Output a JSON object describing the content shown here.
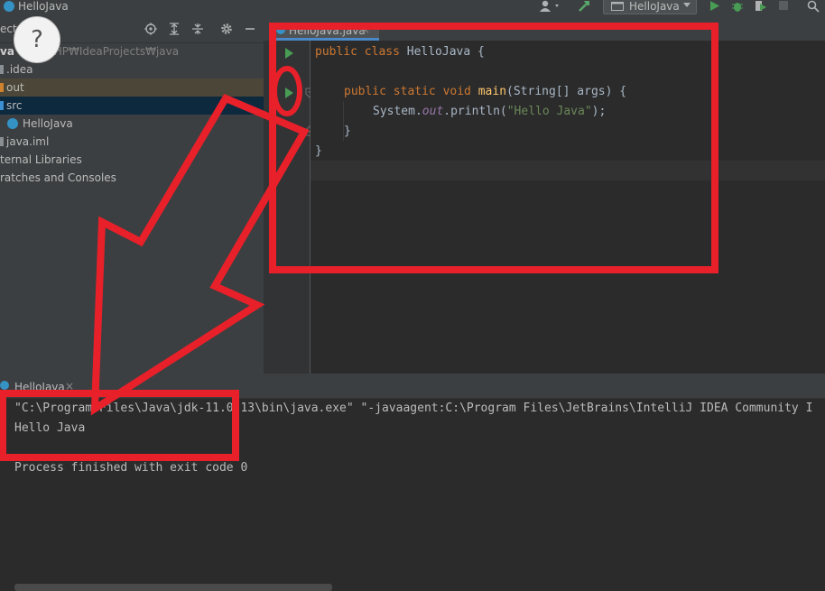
{
  "window": {
    "title": "HelloJava"
  },
  "toolbar": {
    "run_config": "HelloJava"
  },
  "project": {
    "header_label": "ect",
    "root_label": "va",
    "root_path": "HP₩IdeaProjects₩java",
    "items": [
      {
        "label": ".idea"
      },
      {
        "label": "out"
      },
      {
        "label": "src"
      },
      {
        "label": "HelloJava"
      },
      {
        "label": "java.iml"
      },
      {
        "label": "ternal Libraries"
      },
      {
        "label": "ratches and Consoles"
      }
    ]
  },
  "editor": {
    "tab_label": "HelloJava.java",
    "tab_close": "×",
    "code": {
      "l1_kw": "public class ",
      "l1_name": "HelloJava {",
      "l2_kw": "public static void ",
      "l2_method": "main",
      "l2_rest": "(String[] args) {",
      "l3_a": "System.",
      "l3_out": "out",
      "l3_b": ".println(",
      "l3_str": "\"Hello Java\"",
      "l3_c": ");",
      "l4": "}",
      "l5": "}"
    }
  },
  "run": {
    "tab_label": "HelloJava",
    "tab_close": "×",
    "lines": {
      "cmd": "\"C:\\Program Files\\Java\\jdk-11.0.13\\bin\\java.exe\" \"-javaagent:C:\\Program Files\\JetBrains\\IntelliJ IDEA Community I",
      "output": "Hello Java",
      "exit": "Process finished with exit code 0"
    }
  },
  "help": {
    "label": "?"
  },
  "colors": {
    "annotation": "#e8202a",
    "run_green": "#499c54",
    "accent": "#4a88c7"
  },
  "icons": [
    "c-class-icon",
    "user-icon",
    "hammer-icon",
    "run-icon",
    "debug-icon",
    "coverage-icon",
    "stop-icon",
    "search-icon",
    "target-icon",
    "expand-all-icon",
    "collapse-all-icon",
    "gear-icon",
    "minimize-icon",
    "run-gutter-icon",
    "fold-icon"
  ]
}
